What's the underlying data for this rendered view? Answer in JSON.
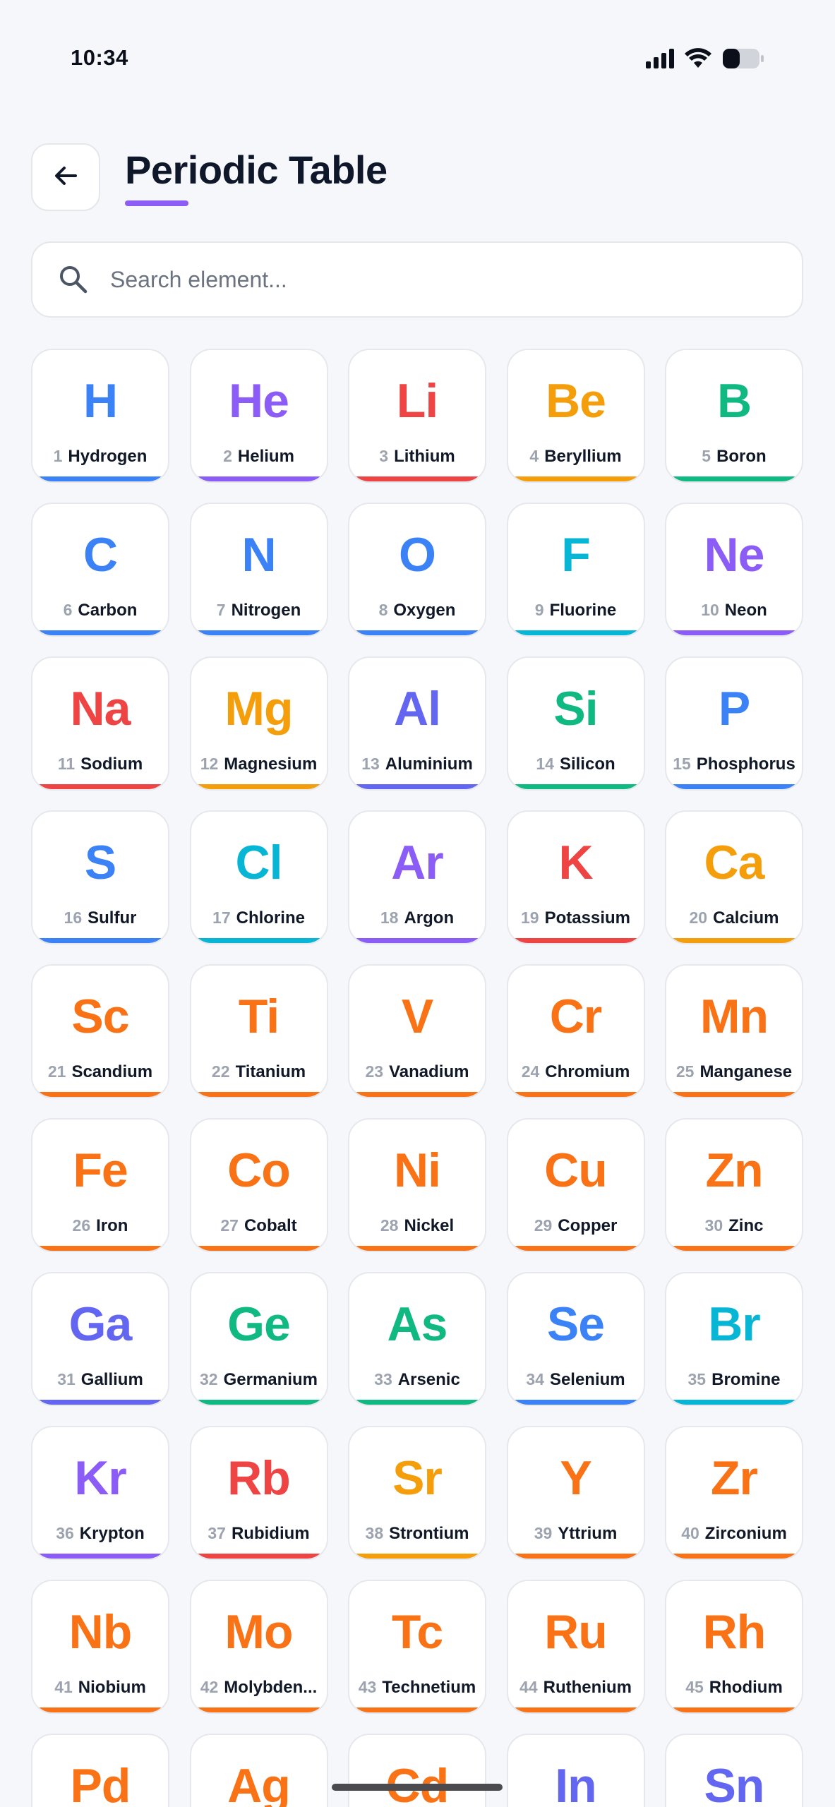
{
  "status_bar": {
    "time": "10:34"
  },
  "header": {
    "title": "Periodic Table"
  },
  "search": {
    "placeholder": "Search element..."
  },
  "colors": {
    "blue": "#3b82f6",
    "purple": "#8b5cf6",
    "red": "#ef4444",
    "amber": "#f59e0b",
    "green": "#10b981",
    "cyan": "#06b6d4",
    "orange": "#f97316",
    "indigo": "#6366f1",
    "title_underline": "#8b5cf6"
  },
  "elements": [
    {
      "number": "1",
      "symbol": "H",
      "name": "Hydrogen",
      "color": "blue"
    },
    {
      "number": "2",
      "symbol": "He",
      "name": "Helium",
      "color": "purple"
    },
    {
      "number": "3",
      "symbol": "Li",
      "name": "Lithium",
      "color": "red"
    },
    {
      "number": "4",
      "symbol": "Be",
      "name": "Beryllium",
      "color": "amber"
    },
    {
      "number": "5",
      "symbol": "B",
      "name": "Boron",
      "color": "green"
    },
    {
      "number": "6",
      "symbol": "C",
      "name": "Carbon",
      "color": "blue"
    },
    {
      "number": "7",
      "symbol": "N",
      "name": "Nitrogen",
      "color": "blue"
    },
    {
      "number": "8",
      "symbol": "O",
      "name": "Oxygen",
      "color": "blue"
    },
    {
      "number": "9",
      "symbol": "F",
      "name": "Fluorine",
      "color": "cyan"
    },
    {
      "number": "10",
      "symbol": "Ne",
      "name": "Neon",
      "color": "purple"
    },
    {
      "number": "11",
      "symbol": "Na",
      "name": "Sodium",
      "color": "red"
    },
    {
      "number": "12",
      "symbol": "Mg",
      "name": "Magnesium",
      "color": "amber"
    },
    {
      "number": "13",
      "symbol": "Al",
      "name": "Aluminium",
      "color": "indigo"
    },
    {
      "number": "14",
      "symbol": "Si",
      "name": "Silicon",
      "color": "green"
    },
    {
      "number": "15",
      "symbol": "P",
      "name": "Phosphorus",
      "color": "blue"
    },
    {
      "number": "16",
      "symbol": "S",
      "name": "Sulfur",
      "color": "blue"
    },
    {
      "number": "17",
      "symbol": "Cl",
      "name": "Chlorine",
      "color": "cyan"
    },
    {
      "number": "18",
      "symbol": "Ar",
      "name": "Argon",
      "color": "purple"
    },
    {
      "number": "19",
      "symbol": "K",
      "name": "Potassium",
      "color": "red"
    },
    {
      "number": "20",
      "symbol": "Ca",
      "name": "Calcium",
      "color": "amber"
    },
    {
      "number": "21",
      "symbol": "Sc",
      "name": "Scandium",
      "color": "orange"
    },
    {
      "number": "22",
      "symbol": "Ti",
      "name": "Titanium",
      "color": "orange"
    },
    {
      "number": "23",
      "symbol": "V",
      "name": "Vanadium",
      "color": "orange"
    },
    {
      "number": "24",
      "symbol": "Cr",
      "name": "Chromium",
      "color": "orange"
    },
    {
      "number": "25",
      "symbol": "Mn",
      "name": "Manganese",
      "color": "orange"
    },
    {
      "number": "26",
      "symbol": "Fe",
      "name": "Iron",
      "color": "orange"
    },
    {
      "number": "27",
      "symbol": "Co",
      "name": "Cobalt",
      "color": "orange"
    },
    {
      "number": "28",
      "symbol": "Ni",
      "name": "Nickel",
      "color": "orange"
    },
    {
      "number": "29",
      "symbol": "Cu",
      "name": "Copper",
      "color": "orange"
    },
    {
      "number": "30",
      "symbol": "Zn",
      "name": "Zinc",
      "color": "orange"
    },
    {
      "number": "31",
      "symbol": "Ga",
      "name": "Gallium",
      "color": "indigo"
    },
    {
      "number": "32",
      "symbol": "Ge",
      "name": "Germanium",
      "color": "green"
    },
    {
      "number": "33",
      "symbol": "As",
      "name": "Arsenic",
      "color": "green"
    },
    {
      "number": "34",
      "symbol": "Se",
      "name": "Selenium",
      "color": "blue"
    },
    {
      "number": "35",
      "symbol": "Br",
      "name": "Bromine",
      "color": "cyan"
    },
    {
      "number": "36",
      "symbol": "Kr",
      "name": "Krypton",
      "color": "purple"
    },
    {
      "number": "37",
      "symbol": "Rb",
      "name": "Rubidium",
      "color": "red"
    },
    {
      "number": "38",
      "symbol": "Sr",
      "name": "Strontium",
      "color": "amber"
    },
    {
      "number": "39",
      "symbol": "Y",
      "name": "Yttrium",
      "color": "orange"
    },
    {
      "number": "40",
      "symbol": "Zr",
      "name": "Zirconium",
      "color": "orange"
    },
    {
      "number": "41",
      "symbol": "Nb",
      "name": "Niobium",
      "color": "orange"
    },
    {
      "number": "42",
      "symbol": "Mo",
      "name": "Molybden...",
      "color": "orange"
    },
    {
      "number": "43",
      "symbol": "Tc",
      "name": "Technetium",
      "color": "orange"
    },
    {
      "number": "44",
      "symbol": "Ru",
      "name": "Ruthenium",
      "color": "orange"
    },
    {
      "number": "45",
      "symbol": "Rh",
      "name": "Rhodium",
      "color": "orange"
    },
    {
      "number": "",
      "symbol": "Pd",
      "name": "",
      "color": "orange"
    },
    {
      "number": "",
      "symbol": "Ag",
      "name": "",
      "color": "orange"
    },
    {
      "number": "",
      "symbol": "Cd",
      "name": "",
      "color": "orange"
    },
    {
      "number": "",
      "symbol": "In",
      "name": "",
      "color": "indigo"
    },
    {
      "number": "",
      "symbol": "Sn",
      "name": "",
      "color": "indigo"
    }
  ]
}
